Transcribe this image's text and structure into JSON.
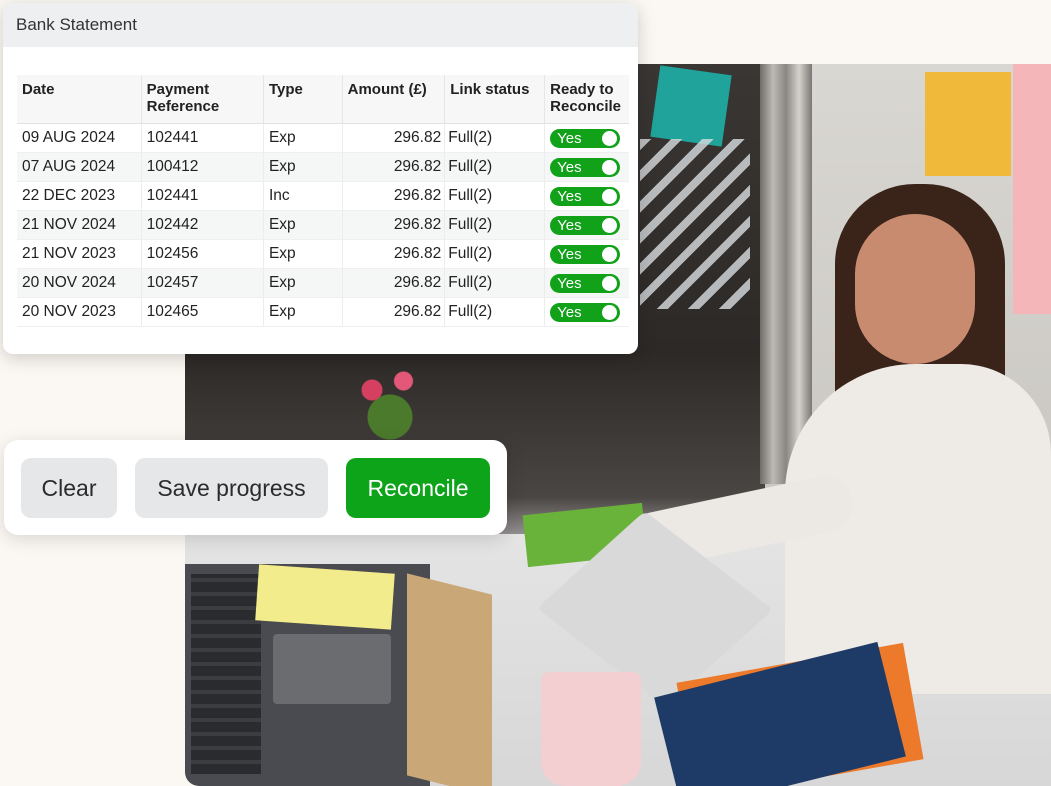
{
  "statement": {
    "title": "Bank Statement",
    "columns": [
      "Date",
      "Payment Reference",
      "Type",
      "Amount (£)",
      "Link status",
      "Ready to Reconcile"
    ],
    "rows": [
      {
        "date": "09 AUG 2024",
        "ref": "102441",
        "type": "Exp",
        "amount": "296.82",
        "link": "Full(2)",
        "ready": "Yes"
      },
      {
        "date": "07 AUG 2024",
        "ref": "100412",
        "type": "Exp",
        "amount": "296.82",
        "link": "Full(2)",
        "ready": "Yes"
      },
      {
        "date": "22 DEC 2023",
        "ref": "102441",
        "type": "Inc",
        "amount": "296.82",
        "link": "Full(2)",
        "ready": "Yes"
      },
      {
        "date": "21 NOV 2024",
        "ref": "102442",
        "type": "Exp",
        "amount": "296.82",
        "link": "Full(2)",
        "ready": "Yes"
      },
      {
        "date": "21 NOV 2023",
        "ref": "102456",
        "type": "Exp",
        "amount": "296.82",
        "link": "Full(2)",
        "ready": "Yes"
      },
      {
        "date": "20 NOV 2024",
        "ref": "102457",
        "type": "Exp",
        "amount": "296.82",
        "link": "Full(2)",
        "ready": "Yes"
      },
      {
        "date": "20 NOV 2023",
        "ref": "102465",
        "type": "Exp",
        "amount": "296.82",
        "link": "Full(2)",
        "ready": "Yes"
      }
    ]
  },
  "actions": {
    "clear_label": "Clear",
    "save_label": "Save progress",
    "reconcile_label": "Reconcile"
  },
  "colors": {
    "accent_green": "#0ea41a",
    "header_bg": "#eeeff0",
    "page_bg": "#fbf7f2"
  },
  "photo": {
    "description_icon": "office-photo"
  }
}
